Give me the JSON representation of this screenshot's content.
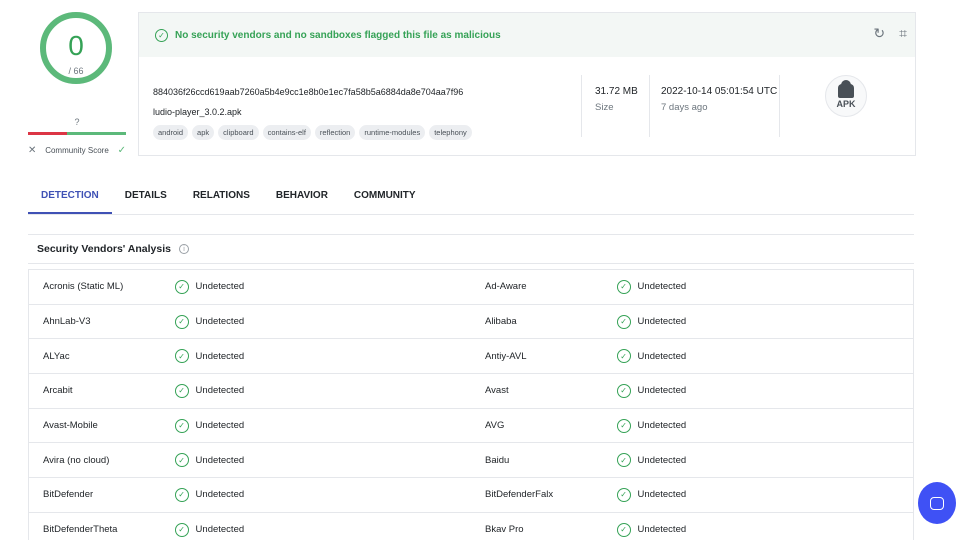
{
  "score": {
    "detections": "0",
    "total": "/ 66",
    "community_value": "?",
    "community_label": "Community Score",
    "dislike_icon": "✕",
    "like_icon": "✓"
  },
  "summary": {
    "banner_text": "No security vendors and no sandboxes flagged this file as malicious",
    "hash": "884036f26ccd619aab7260a5b4e9cc1e8b0e1ec7fa58b5a6884da8e704aa7f96",
    "filename": "ludio-player_3.0.2.apk",
    "tags": [
      "android",
      "apk",
      "clipboard",
      "contains-elf",
      "reflection",
      "runtime-modules",
      "telephony"
    ],
    "size_value": "31.72 MB",
    "size_label": "Size",
    "date_value": "2022-10-14 05:01:54 UTC",
    "date_ago": "7 days ago",
    "file_type_label": "APK",
    "reanalyze_icon": "↻",
    "graph_icon": "⌗"
  },
  "tabs": [
    {
      "label": "DETECTION",
      "active": true
    },
    {
      "label": "DETAILS",
      "active": false
    },
    {
      "label": "RELATIONS",
      "active": false
    },
    {
      "label": "BEHAVIOR",
      "active": false
    },
    {
      "label": "COMMUNITY",
      "active": false
    }
  ],
  "section": {
    "title": "Security Vendors' Analysis",
    "info_icon": "i"
  },
  "vendors": [
    {
      "left": "Acronis (Static ML)",
      "left_result": "Undetected",
      "right": "Ad-Aware",
      "right_result": "Undetected"
    },
    {
      "left": "AhnLab-V3",
      "left_result": "Undetected",
      "right": "Alibaba",
      "right_result": "Undetected"
    },
    {
      "left": "ALYac",
      "left_result": "Undetected",
      "right": "Antiy-AVL",
      "right_result": "Undetected"
    },
    {
      "left": "Arcabit",
      "left_result": "Undetected",
      "right": "Avast",
      "right_result": "Undetected"
    },
    {
      "left": "Avast-Mobile",
      "left_result": "Undetected",
      "right": "AVG",
      "right_result": "Undetected"
    },
    {
      "left": "Avira (no cloud)",
      "left_result": "Undetected",
      "right": "Baidu",
      "right_result": "Undetected"
    },
    {
      "left": "BitDefender",
      "left_result": "Undetected",
      "right": "BitDefenderFalx",
      "right_result": "Undetected"
    },
    {
      "left": "BitDefenderTheta",
      "left_result": "Undetected",
      "right": "Bkav Pro",
      "right_result": "Undetected"
    }
  ],
  "colors": {
    "clean_green": "#35a256",
    "accent_blue": "#3f51b5",
    "chat_blue": "#3f51f5"
  }
}
